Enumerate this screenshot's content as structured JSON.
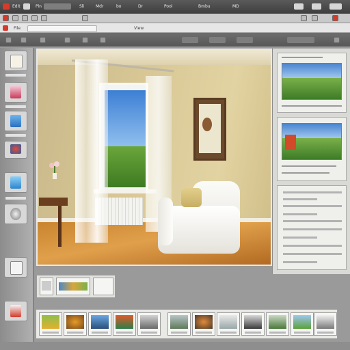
{
  "window": {
    "menu_items": [
      "Edit",
      "Pin",
      "Sli",
      "Mdr",
      "bo",
      "Dr",
      "Pool",
      "Bmbu",
      "MD"
    ],
    "toolbar_labels": [
      "File",
      "View"
    ],
    "options_labels": []
  },
  "colors": {
    "accent_red": "#d43b2a",
    "panel_bg": "#d9d9d6",
    "toolbar_dark": "#4a4a4a"
  },
  "icons": [
    "document-icon",
    "image-icon",
    "monitor-icon",
    "brush-icon",
    "camera-icon",
    "settings-icon",
    "stack-icon"
  ],
  "filmstrip": {
    "items": [
      "frog",
      "flower",
      "landscape",
      "sunset",
      "clouds",
      "mountain",
      "tiger",
      "mist",
      "ridge",
      "forest",
      "field",
      "shore"
    ]
  }
}
